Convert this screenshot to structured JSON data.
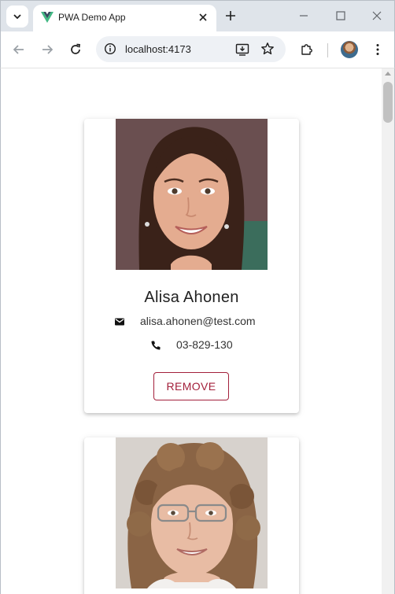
{
  "browser": {
    "tab_title": "PWA Demo App",
    "url": "localhost:4173"
  },
  "contacts": [
    {
      "name": "Alisa Ahonen",
      "email": "alisa.ahonen@test.com",
      "phone": "03-829-130",
      "remove_label": "REMOVE"
    }
  ],
  "icons": {
    "email": "email-icon",
    "phone": "phone-icon"
  },
  "colors": {
    "accent": "#a3203b",
    "vue_green": "#41b883",
    "vue_dark": "#35495e"
  }
}
